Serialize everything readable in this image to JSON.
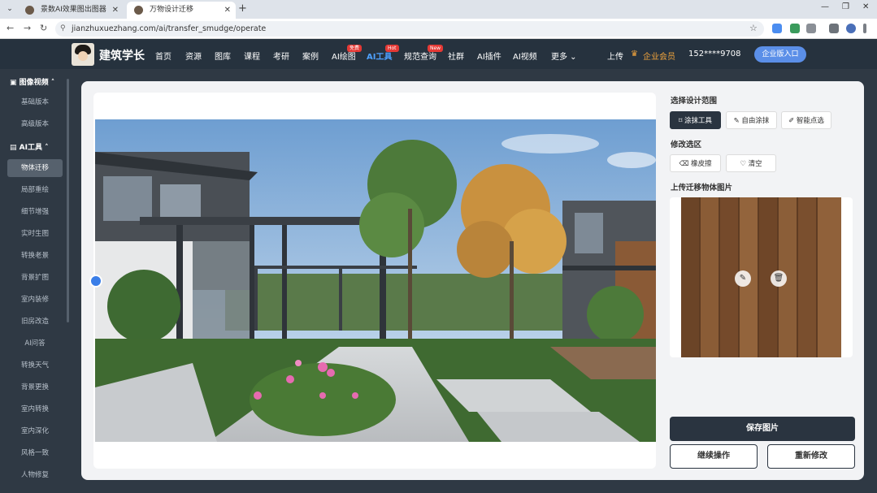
{
  "browser": {
    "tabs": [
      {
        "label": "景数AI效果图出图器"
      },
      {
        "label": "万物设计迁移"
      }
    ],
    "url": "jianzhuxuezhang.com/ai/transfer_smudge/operate"
  },
  "header": {
    "logo_text": "建筑学长",
    "nav": [
      {
        "label": "首页"
      },
      {
        "label": "资源"
      },
      {
        "label": "图库"
      },
      {
        "label": "课程"
      },
      {
        "label": "考研"
      },
      {
        "label": "案例"
      },
      {
        "label": "AI绘图",
        "badge": "免费"
      },
      {
        "label": "AI工具",
        "badge": "Hot"
      },
      {
        "label": "规范查询",
        "badge": "New"
      },
      {
        "label": "社群"
      },
      {
        "label": "AI插件"
      },
      {
        "label": "AI视频"
      },
      {
        "label": "更多 ⌄"
      }
    ],
    "upload_label": "上传",
    "vip_label": "企业会员",
    "phone": "152****9708",
    "enterprise_btn": "企业版入口"
  },
  "sidebar": {
    "group1": "图像视频",
    "group1_items": [
      {
        "label": "基础版本"
      },
      {
        "label": "高级版本"
      }
    ],
    "group2": "AI工具",
    "group2_items": [
      {
        "label": "物体迁移"
      },
      {
        "label": "局部重绘"
      },
      {
        "label": "细节增强"
      },
      {
        "label": "实时生图"
      },
      {
        "label": "转换老景"
      },
      {
        "label": "背景扩图"
      },
      {
        "label": "室内装修"
      },
      {
        "label": "旧房改造"
      },
      {
        "label": "AI问答"
      },
      {
        "label": "转换天气"
      },
      {
        "label": "背景更换"
      },
      {
        "label": "室内转换"
      },
      {
        "label": "室内深化"
      },
      {
        "label": "风格一致"
      },
      {
        "label": "人物修复"
      }
    ]
  },
  "panel": {
    "select_title": "选择设计范围",
    "tools": [
      {
        "label": "涂抹工具"
      },
      {
        "label": "自由涂抹"
      },
      {
        "label": "智能点选"
      }
    ],
    "modify_title": "修改选区",
    "modify_tools": [
      {
        "label": "橡皮擦"
      },
      {
        "label": "清空"
      }
    ],
    "upload_title": "上传迁移物体图片",
    "save_btn": "保存图片",
    "continue_btn": "继续操作",
    "redo_btn": "重新修改"
  },
  "colors": {
    "header_bg": "#26323e",
    "sidebar_bg": "#2f3944",
    "accent_blue": "#4ea1ff",
    "dark_btn": "#2a3440",
    "vip_orange": "#f3a53c"
  }
}
